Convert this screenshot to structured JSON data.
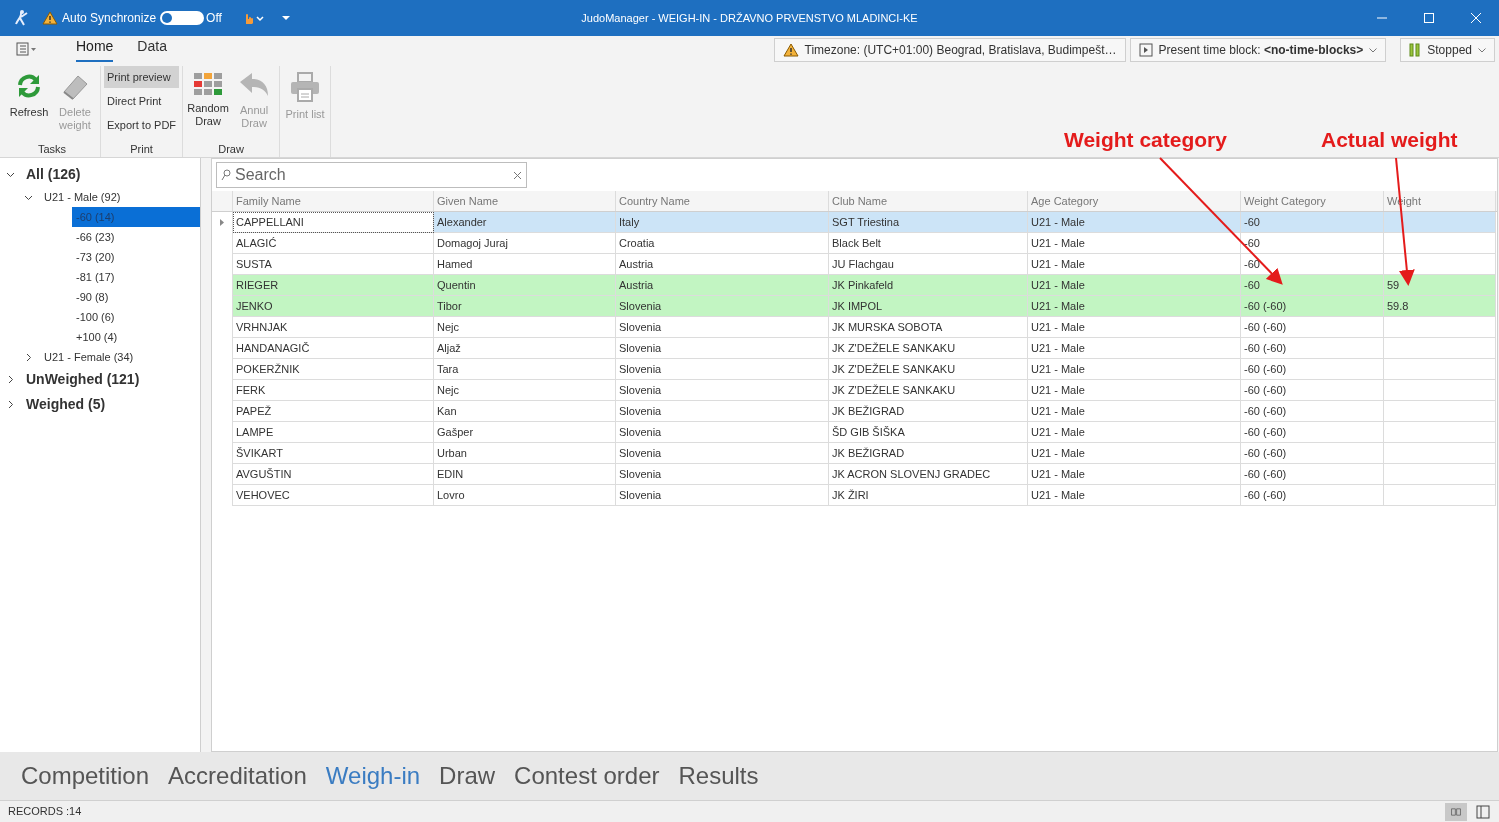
{
  "title_bar": {
    "sync_label": "Auto Synchronize",
    "sync_on": false,
    "sync_state": "Off",
    "title": "JudoManager - WEIGH-IN - DRŽAVNO PRVENSTVO MLADINCI-KE"
  },
  "ribbon": {
    "tabs": [
      {
        "label": "Home",
        "selected": true
      },
      {
        "label": "Data",
        "selected": false
      }
    ],
    "info_buttons": [
      {
        "kind": "timezone",
        "label": "Timezone: (UTC+01:00) Beograd, Bratislava, Budimpešt…"
      },
      {
        "kind": "timeblock",
        "label": "Present time block: **<no-time-blocks>**"
      },
      {
        "kind": "stopped",
        "label": "Stopped"
      }
    ],
    "groups": [
      {
        "label": "Tasks",
        "items": [
          {
            "kind": "refresh",
            "label": "Refresh",
            "disabled": false
          },
          {
            "kind": "eraser",
            "label": "Delete weight",
            "disabled": true
          }
        ]
      },
      {
        "label": "Print",
        "items": [
          {
            "kind": "small",
            "label": "Print preview",
            "pressed": true
          },
          {
            "kind": "small",
            "label": "Direct Print",
            "pressed": false
          },
          {
            "kind": "small",
            "label": "Export to PDF",
            "pressed": false
          }
        ]
      },
      {
        "label": "Draw",
        "items": [
          {
            "kind": "grid",
            "label": "Random Draw",
            "disabled": false
          },
          {
            "kind": "undo",
            "label": "Annul Draw",
            "disabled": true
          }
        ]
      },
      {
        "items": [
          {
            "kind": "printer",
            "label": "Print list",
            "disabled": true
          }
        ]
      }
    ]
  },
  "tree": [
    {
      "label": "All (126)",
      "expanded": true,
      "selected": false,
      "children": [
        {
          "label": "U21 - Male (92)",
          "expanded": true,
          "selected": false,
          "children": [
            {
              "label": "-60 (14)",
              "selected": true
            },
            {
              "label": "-66 (23)",
              "selected": false
            },
            {
              "label": "-73 (20)",
              "selected": false
            },
            {
              "label": "-81 (17)",
              "selected": false
            },
            {
              "label": "-90 (8)",
              "selected": false
            },
            {
              "label": "-100 (6)",
              "selected": false
            },
            {
              "label": "+100 (4)",
              "selected": false
            }
          ]
        },
        {
          "label": "U21 - Female (34)",
          "expanded": false,
          "selected": false
        }
      ]
    },
    {
      "label": "UnWeighed (121)",
      "expanded": false,
      "selected": false
    },
    {
      "label": "Weighed (5)",
      "expanded": false,
      "selected": false
    }
  ],
  "search": {
    "placeholder": "Search"
  },
  "table": {
    "columns": [
      "Family Name",
      "Given Name",
      "Country Name",
      "Club Name",
      "Age Category",
      "Weight Category",
      "Weight"
    ],
    "rows": [
      {
        "selected": true,
        "weighed": false,
        "cells": [
          "CAPPELLANI",
          "Alexander",
          "Italy",
          "SGT Triestina",
          "U21 - Male",
          "-60",
          ""
        ]
      },
      {
        "selected": false,
        "weighed": false,
        "cells": [
          "ALAGIĆ",
          "Domagoj Juraj",
          "Croatia",
          "Black Belt",
          "U21 - Male",
          "-60",
          ""
        ]
      },
      {
        "selected": false,
        "weighed": false,
        "cells": [
          "SUSTA",
          "Hamed",
          "Austria",
          "JU Flachgau",
          "U21 - Male",
          "-60",
          ""
        ]
      },
      {
        "selected": false,
        "weighed": true,
        "cells": [
          "RIEGER",
          "Quentin",
          "Austria",
          "JK Pinkafeld",
          "U21 - Male",
          "-60",
          "59"
        ]
      },
      {
        "selected": false,
        "weighed": true,
        "cells": [
          "JENKO",
          "Tibor",
          "Slovenia",
          "JK IMPOL",
          "U21 - Male",
          "-60 (-60)",
          "59.8"
        ]
      },
      {
        "selected": false,
        "weighed": false,
        "cells": [
          "VRHNJAK",
          "Nejc",
          "Slovenia",
          "JK MURSKA SOBOTA",
          "U21 - Male",
          "-60 (-60)",
          ""
        ]
      },
      {
        "selected": false,
        "weighed": false,
        "cells": [
          "HANDANAGIČ",
          "Aljaž",
          "Slovenia",
          "JK Z'DEŽELE SANKAKU",
          "U21 - Male",
          "-60 (-60)",
          ""
        ]
      },
      {
        "selected": false,
        "weighed": false,
        "cells": [
          "POKERŽNIK",
          "Tara",
          "Slovenia",
          "JK Z'DEŽELE SANKAKU",
          "U21 - Male",
          "-60 (-60)",
          ""
        ]
      },
      {
        "selected": false,
        "weighed": false,
        "cells": [
          "FERK",
          "Nejc",
          "Slovenia",
          "JK Z'DEŽELE SANKAKU",
          "U21 - Male",
          "-60 (-60)",
          ""
        ]
      },
      {
        "selected": false,
        "weighed": false,
        "cells": [
          "PAPEŽ",
          "Kan",
          "Slovenia",
          "JK BEŽIGRAD",
          "U21 - Male",
          "-60 (-60)",
          ""
        ]
      },
      {
        "selected": false,
        "weighed": false,
        "cells": [
          "LAMPE",
          "Gašper",
          "Slovenia",
          "ŠD GIB ŠIŠKA",
          "U21 - Male",
          "-60 (-60)",
          ""
        ]
      },
      {
        "selected": false,
        "weighed": false,
        "cells": [
          "ŠVIKART",
          "Urban",
          "Slovenia",
          "JK BEŽIGRAD",
          "U21 - Male",
          "-60 (-60)",
          ""
        ]
      },
      {
        "selected": false,
        "weighed": false,
        "cells": [
          "AVGUŠTIN",
          "EDIN",
          "Slovenia",
          "JK ACRON SLOVENJ GRADEC",
          "U21 - Male",
          "-60 (-60)",
          ""
        ]
      },
      {
        "selected": false,
        "weighed": false,
        "cells": [
          "VEHOVEC",
          "Lovro",
          "Slovenia",
          "JK ŽIRI",
          "U21 - Male",
          "-60 (-60)",
          ""
        ]
      }
    ]
  },
  "annotations": [
    {
      "label": "Weight category"
    },
    {
      "label": "Actual weight"
    }
  ],
  "bottom_nav": [
    {
      "label": "Competition",
      "selected": false
    },
    {
      "label": "Accreditation",
      "selected": false
    },
    {
      "label": "Weigh-in",
      "selected": true
    },
    {
      "label": "Draw",
      "selected": false
    },
    {
      "label": "Contest order",
      "selected": false
    },
    {
      "label": "Results",
      "selected": false
    }
  ],
  "status_bar": {
    "records": "RECORDS :14"
  }
}
